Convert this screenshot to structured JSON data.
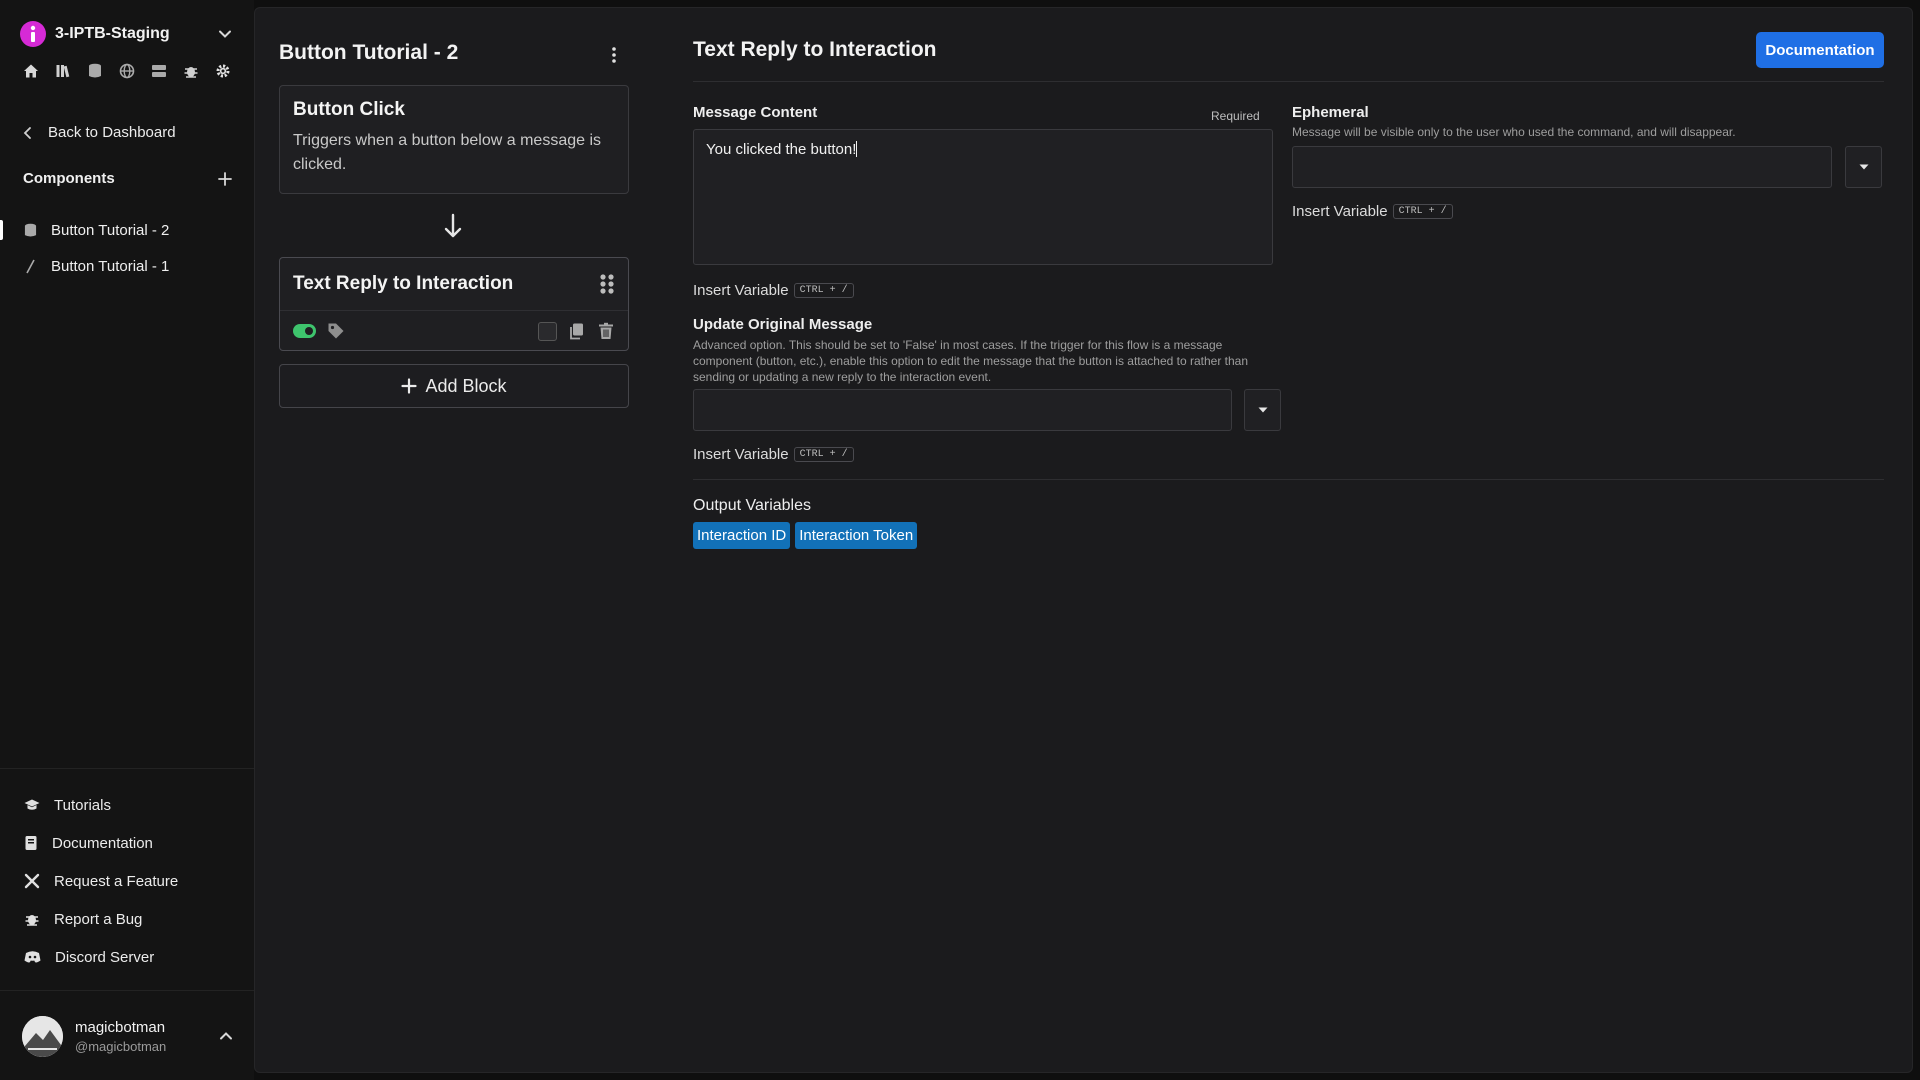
{
  "sidebar": {
    "server_name": "3-IPTB-Staging",
    "nav_icons": [
      "home-icon",
      "library-icon",
      "database-icon",
      "globe-icon",
      "storage-icon",
      "bug-icon",
      "gear-icon"
    ],
    "back_label": "Back to Dashboard",
    "components_label": "Components",
    "components": [
      {
        "label": "Button Tutorial - 2",
        "icon": "database-icon",
        "active": true
      },
      {
        "label": "Button Tutorial - 1",
        "icon": "slash-icon",
        "active": false
      }
    ],
    "bottom_links": [
      {
        "label": "Tutorials",
        "icon": "graduation-cap-icon"
      },
      {
        "label": "Documentation",
        "icon": "book-icon"
      },
      {
        "label": "Request a Feature",
        "icon": "tools-icon"
      },
      {
        "label": "Report a Bug",
        "icon": "bug-icon"
      },
      {
        "label": "Discord Server",
        "icon": "discord-icon"
      }
    ],
    "user": {
      "name": "magicbotman",
      "handle": "@magicbotman"
    }
  },
  "flow": {
    "title": "Button Tutorial - 2",
    "trigger": {
      "title": "Button Click",
      "description": "Triggers when a button below a message is clicked."
    },
    "action": {
      "title": "Text Reply to Interaction",
      "enabled": true
    },
    "add_block_label": "Add Block"
  },
  "editor": {
    "title": "Text Reply to Interaction",
    "documentation_label": "Documentation",
    "message_content": {
      "label": "Message Content",
      "required_label": "Required",
      "value": "You clicked the button!"
    },
    "insert_variable": {
      "label": "Insert Variable",
      "shortcut": "CTRL + /"
    },
    "update_original": {
      "label": "Update Original Message",
      "help": "Advanced option. This should be set to 'False' in most cases. If the trigger for this flow is a message component (button, etc.), enable this option to edit the message that the button is attached to rather than sending or updating a new reply to the interaction event.",
      "value": ""
    },
    "ephemeral": {
      "label": "Ephemeral",
      "help": "Message will be visible only to the user who used the command, and will disappear.",
      "value": ""
    },
    "output_variables": {
      "label": "Output Variables",
      "items": [
        "Interaction ID",
        "Interaction Token"
      ]
    }
  },
  "colors": {
    "accent": "#1f6fe5",
    "chip": "#1271b8",
    "toggle_on": "#3ec46d",
    "server_logo": "#d62ad6"
  }
}
